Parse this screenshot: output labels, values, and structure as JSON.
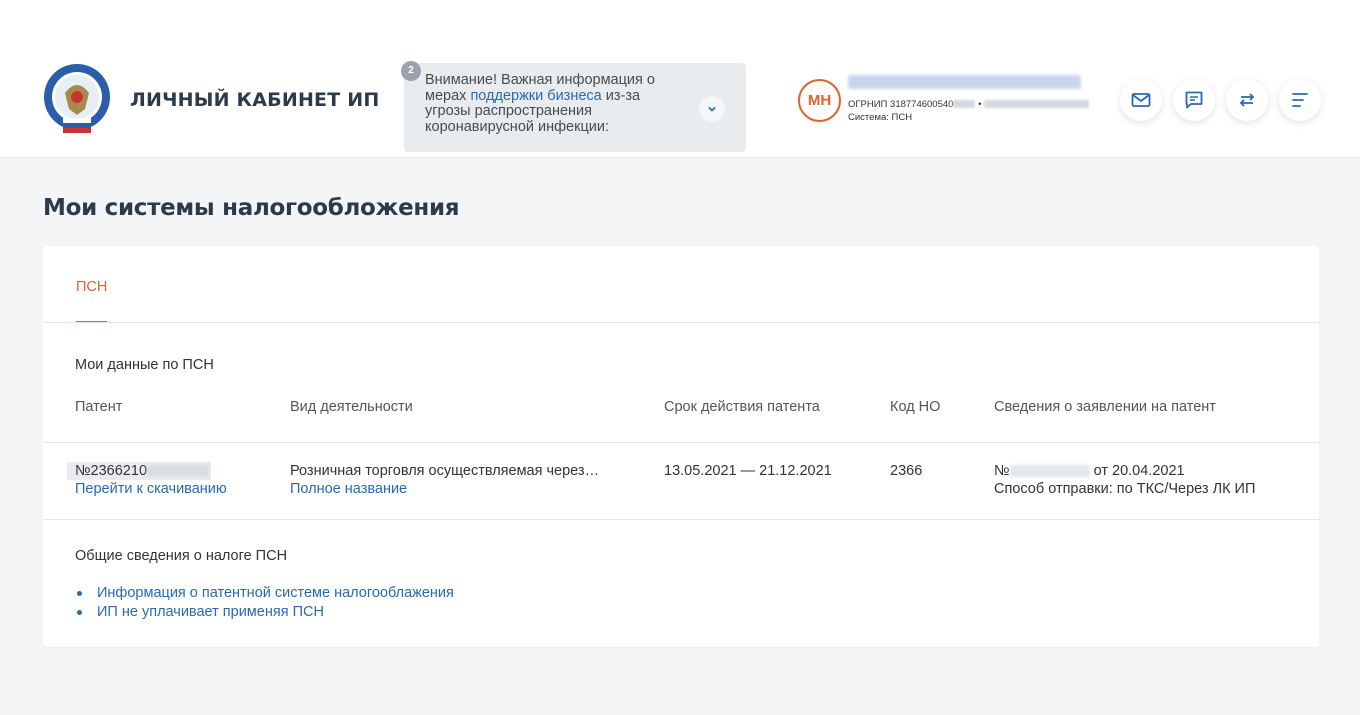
{
  "header": {
    "brand": "ЛИЧНЫЙ КАБИНЕТ ИП",
    "notice": {
      "badge": "2",
      "text_before": "Внимание! Важная информация о мерах ",
      "link": "поддержки бизнеса",
      "text_after": " из-за угрозы распространения коронавирусной инфекции:"
    },
    "user": {
      "initials": "МН",
      "ogrnip_label": "ОГРНИП",
      "ogrnip_visible": "318774600540",
      "system_label": "Система:",
      "system_value": "ПСН"
    }
  },
  "page": {
    "title": "Мои системы налогообложения",
    "tab": "ПСН"
  },
  "psn": {
    "section_title": "Мои данные по ПСН",
    "columns": [
      "Патент",
      "Вид деятельности",
      "Срок действия патента",
      "Код НО",
      "Сведения о заявлении на патент"
    ],
    "row": {
      "patent_number": "№2366210",
      "download_link": "Перейти к скачиванию",
      "activity": "Розничная торговля осуществляемая через…",
      "activity_link": "Полное название",
      "period": "13.05.2021 — 21.12.2021",
      "code": "2366",
      "application_prefix": "№",
      "application_date": "от 20.04.2021",
      "send_method": "Способ отправки: по ТКС/Через ЛК ИП"
    }
  },
  "general": {
    "title": "Общие сведения о налоге ПСН",
    "links": [
      "Информация о патентной системе налогооблажения",
      "ИП не уплачивает применяя ПСН"
    ]
  },
  "colors": {
    "accent": "#e0622e",
    "link": "#2a69b0",
    "background": "#f3f5f7"
  }
}
